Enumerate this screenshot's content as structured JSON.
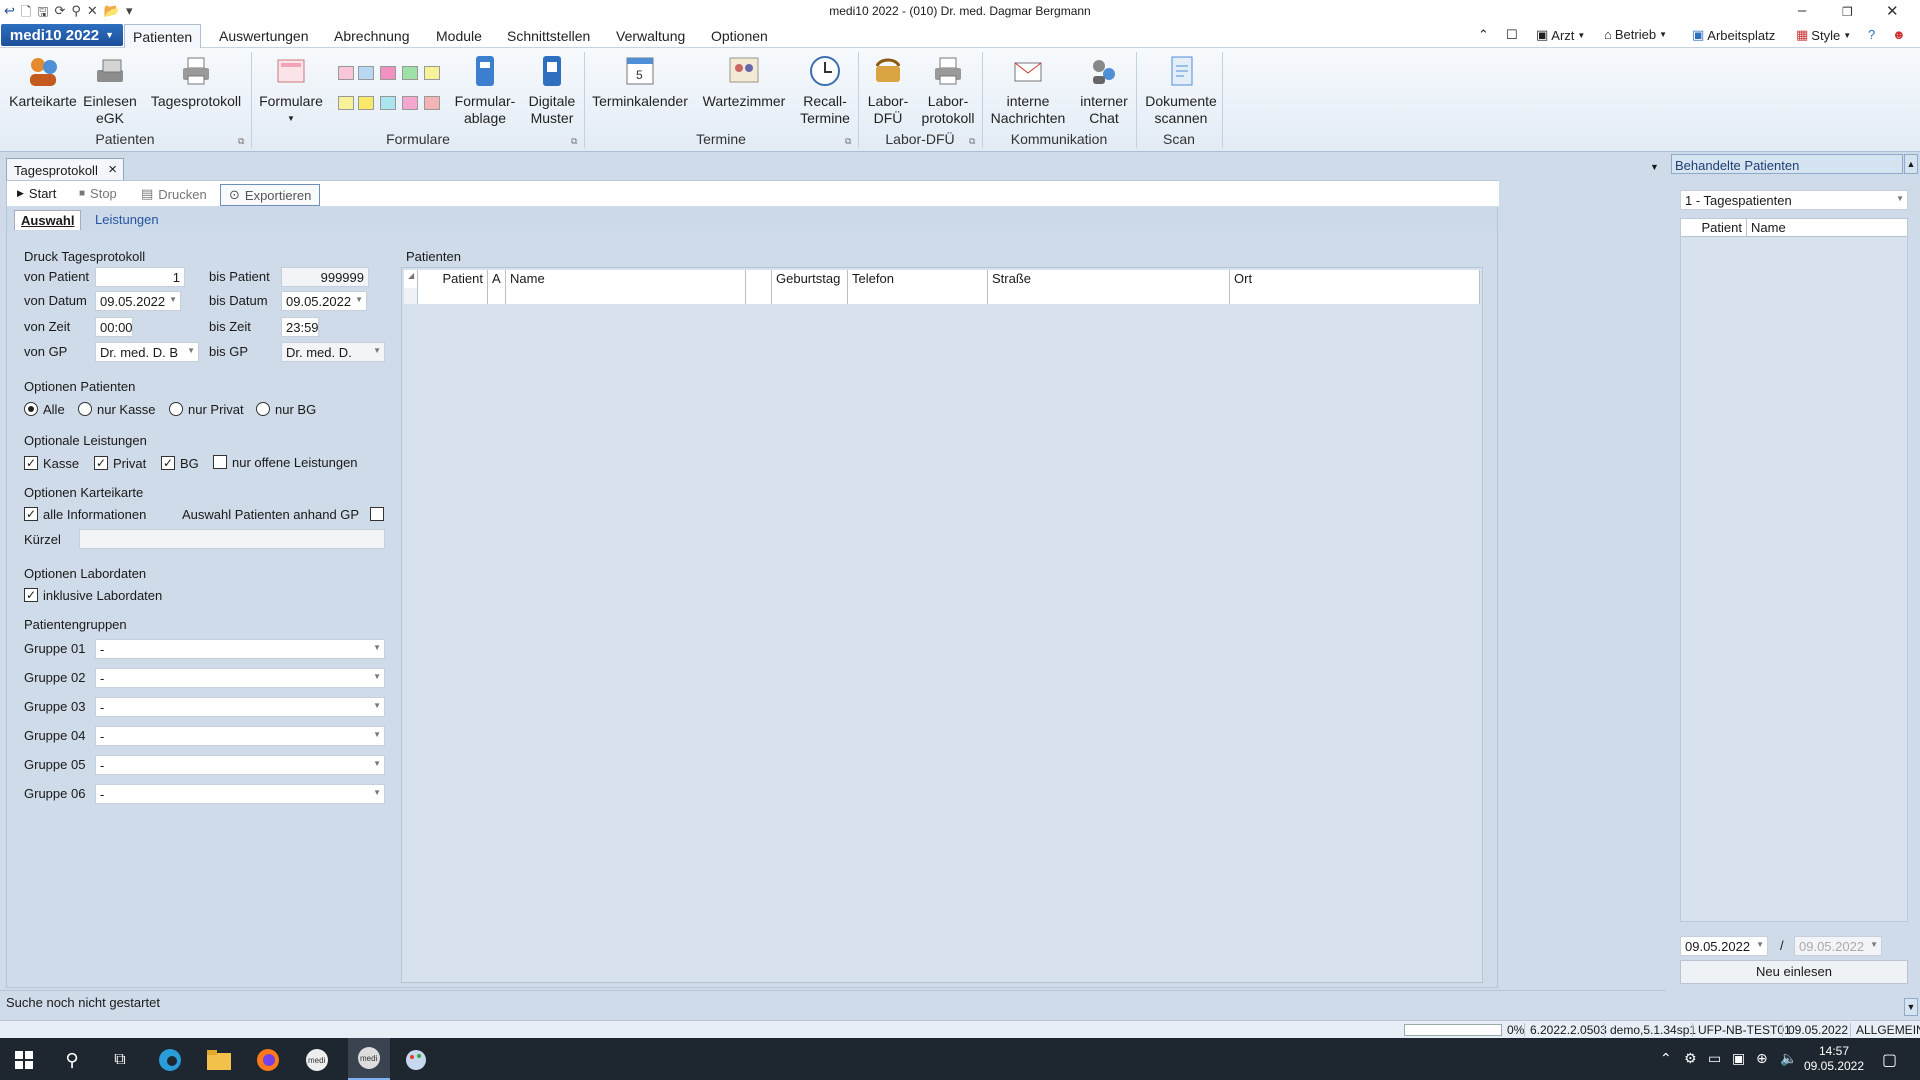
{
  "window": {
    "title": "medi10 2022 - (010) Dr. med. Dagmar Bergmann"
  },
  "ribbon_tabs": {
    "app_menu": "medi10 2022",
    "tabs": [
      "Patienten",
      "Auswertungen",
      "Abrechnung",
      "Module",
      "Schnittstellen",
      "Verwaltung",
      "Optionen"
    ],
    "active": "Patienten",
    "right": {
      "arzt": "Arzt",
      "betrieb": "Betrieb",
      "arbeitsplatz": "Arbeitsplatz",
      "style": "Style"
    }
  },
  "ribbon": {
    "karteikarte": "Karteikarte",
    "einlesen_1": "Einlesen",
    "einlesen_2": "eGK",
    "tagesprotokoll": "Tagesprotokoll",
    "formulare": "Formulare",
    "formularablage_1": "Formular-",
    "formularablage_2": "ablage",
    "digitale_1": "Digitale",
    "digitale_2": "Muster",
    "terminkalender": "Terminkalender",
    "wartezimmer": "Wartezimmer",
    "recall_1": "Recall-",
    "recall_2": "Termine",
    "labordfu_1": "Labor-",
    "labordfu_2": "DFÜ",
    "laborprot_1": "Labor-",
    "laborprot_2": "protokoll",
    "interne_1": "interne",
    "interne_2": "Nachrichten",
    "chat_1": "interner",
    "chat_2": "Chat",
    "scan_1": "Dokumente",
    "scan_2": "scannen",
    "groups": {
      "patienten": "Patienten",
      "formulare": "Formulare",
      "termine": "Termine",
      "labor": "Labor-DFÜ",
      "kommunikation": "Kommunikation",
      "scan": "Scan"
    }
  },
  "doc_tab": {
    "title": "Tagesprotokoll"
  },
  "toolbar": {
    "start": "Start",
    "stop": "Stop",
    "drucken": "Drucken",
    "exportieren": "Exportieren"
  },
  "subtabs": {
    "auswahl": "Auswahl",
    "leistungen": "Leistungen"
  },
  "form": {
    "druck_title": "Druck Tagesprotokoll",
    "von_patient_label": "von Patient",
    "von_patient": "1",
    "bis_patient_label": "bis Patient",
    "bis_patient": "999999",
    "von_datum_label": "von Datum",
    "von_datum": "09.05.2022",
    "bis_datum_label": "bis Datum",
    "bis_datum": "09.05.2022",
    "von_zeit_label": "von Zeit",
    "von_zeit": "00:00",
    "bis_zeit_label": "bis Zeit",
    "bis_zeit": "23:59",
    "von_gp_label": "von GP",
    "von_gp": "Dr. med. D. B",
    "bis_gp_label": "bis GP",
    "bis_gp": "Dr. med. D.",
    "opt_patienten_title": "Optionen Patienten",
    "radio_alle": "Alle",
    "radio_kasse": "nur Kasse",
    "radio_privat": "nur Privat",
    "radio_bg": "nur BG",
    "opt_leistungen_title": "Optionale Leistungen",
    "chk_kasse": "Kasse",
    "chk_privat": "Privat",
    "chk_bg": "BG",
    "chk_offen": "nur offene Leistungen",
    "opt_kartei_title": "Optionen Karteikarte",
    "chk_alle_info": "alle Informationen",
    "auswahl_gp": "Auswahl Patienten anhand GP",
    "kuerzel_label": "Kürzel",
    "kuerzel": "",
    "opt_labor_title": "Optionen Labordaten",
    "chk_labor": "inklusive Labordaten",
    "gruppen_title": "Patientengruppen",
    "gruppen": [
      {
        "label": "Gruppe 01",
        "value": "-"
      },
      {
        "label": "Gruppe 02",
        "value": "-"
      },
      {
        "label": "Gruppe 03",
        "value": "-"
      },
      {
        "label": "Gruppe 04",
        "value": "-"
      },
      {
        "label": "Gruppe 05",
        "value": "-"
      },
      {
        "label": "Gruppe 06",
        "value": "-"
      }
    ]
  },
  "grid": {
    "title": "Patienten",
    "columns": [
      "Patient",
      "A",
      "Name",
      "",
      "Geburtstag",
      "Telefon",
      "Straße",
      "Ort"
    ]
  },
  "right_panel": {
    "title": "Behandelte Patienten",
    "filter": "1 - Tagespatienten",
    "columns": [
      "Patient",
      "Name"
    ],
    "date_from": "09.05.2022",
    "date_sep": "/",
    "date_to": "09.05.2022",
    "reload": "Neu einlesen"
  },
  "status": {
    "message": "Suche noch nicht gestartet",
    "progress_pct": "0%",
    "version": "6.2022.2.0503",
    "demo": "demo,5.1.34sp1",
    "host": "UFP-NB-TEST01",
    "date": "09.05.2022",
    "mode": "ALLGEMEIN"
  },
  "taskbar": {
    "time": "14:57",
    "date": "09.05.2022"
  },
  "colors": {
    "accent": "#1c4f9a",
    "panel": "#cfdbe8"
  }
}
